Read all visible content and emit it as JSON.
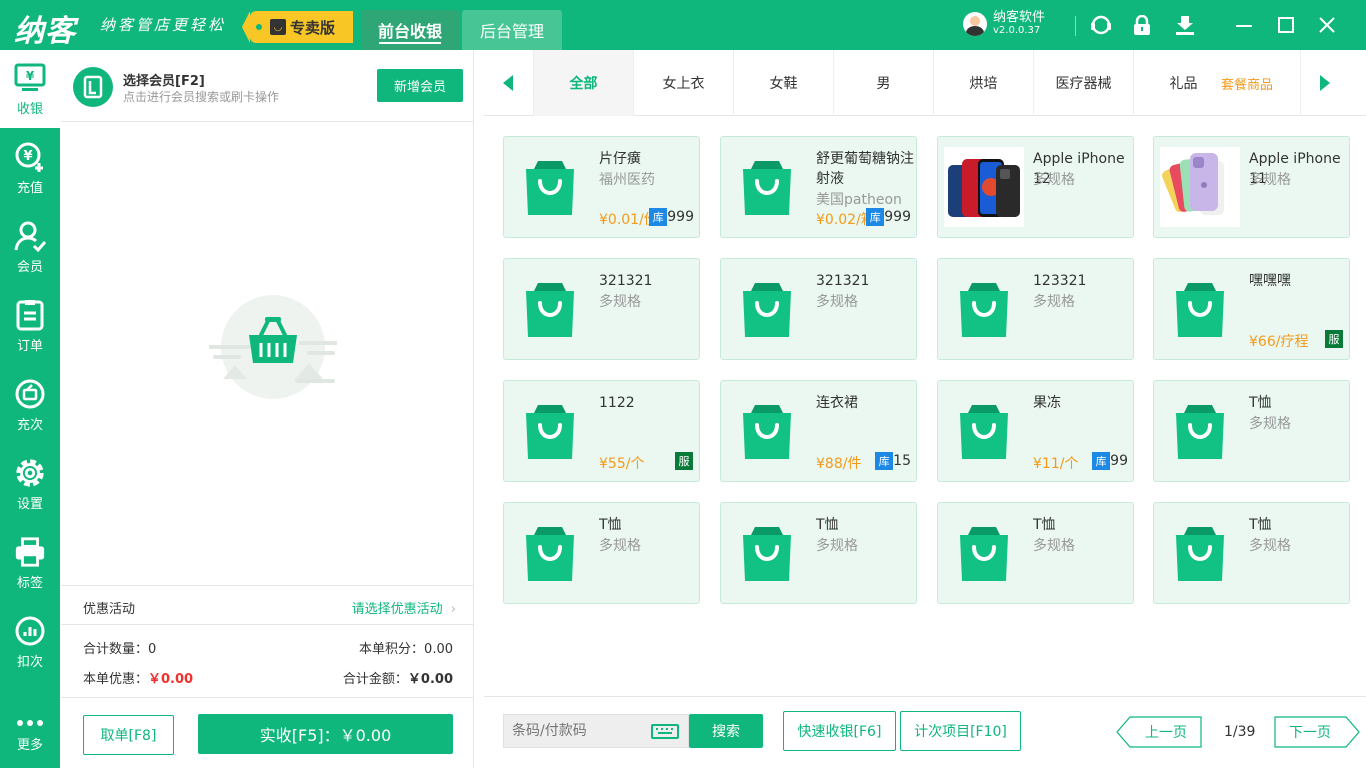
{
  "app": {
    "logo": "纳客",
    "slogan": "纳客管店更轻松",
    "edition": "专卖版",
    "tabs": [
      {
        "label": "前台收银",
        "active": true
      },
      {
        "label": "后台管理",
        "active": false
      }
    ],
    "user": {
      "name": "纳客软件",
      "version": "v2.0.0.37"
    },
    "window_icons": [
      "headset-icon",
      "lock-icon",
      "download-icon",
      "minimize-icon",
      "maximize-icon",
      "close-icon"
    ]
  },
  "sidebar": {
    "items": [
      {
        "label": "收银",
        "icon": "cashier-icon",
        "active": true
      },
      {
        "label": "充值",
        "icon": "recharge-icon",
        "active": false
      },
      {
        "label": "会员",
        "icon": "member-icon",
        "active": false
      },
      {
        "label": "订单",
        "icon": "order-icon",
        "active": false
      },
      {
        "label": "充次",
        "icon": "times-icon",
        "active": false
      },
      {
        "label": "设置",
        "icon": "settings-icon",
        "active": false
      },
      {
        "label": "标签",
        "icon": "printer-icon",
        "active": false
      },
      {
        "label": "扣次",
        "icon": "chart-icon",
        "active": false
      },
      {
        "label": "更多",
        "icon": "more-icon",
        "active": false
      }
    ]
  },
  "member": {
    "title": "选择会员[F2]",
    "subtitle": "点击进行会员搜索或刷卡操作",
    "add_button": "新增会员"
  },
  "promo": {
    "label": "优惠活动",
    "select": "请选择优惠活动"
  },
  "summary": {
    "qty_label": "合计数量：",
    "qty": "0",
    "points_label": "本单积分：",
    "points": "0.00",
    "discount_label": "本单优惠：",
    "discount": "￥0.00",
    "total_label": "合计金额：",
    "total": "￥0.00"
  },
  "actions": {
    "cancel": "取单[F8]",
    "pay": "实收[F5]：￥0.00"
  },
  "categories": [
    "全部",
    "女上衣",
    "女鞋",
    "男",
    "烘培",
    "医疗器械",
    "礼品"
  ],
  "category_tag": "套餐商品",
  "products": [
    {
      "name": "片仔癀",
      "sub": "福州医药",
      "price": "¥0.01/份",
      "stock": "999",
      "badge": "库",
      "img": "bag"
    },
    {
      "name": "舒更葡萄糖钠注射液",
      "sub": "美国patheon",
      "price": "¥0.02/箱",
      "stock": "999",
      "badge": "库",
      "img": "bag"
    },
    {
      "name": "Apple iPhone 12",
      "sub": "多规格",
      "price": "",
      "stock": "",
      "badge": "",
      "img": "iphone12"
    },
    {
      "name": "Apple iPhone 11",
      "sub": "多规格",
      "price": "",
      "stock": "",
      "badge": "",
      "img": "iphone11"
    },
    {
      "name": "321321",
      "sub": "多规格",
      "price": "",
      "stock": "",
      "badge": "",
      "img": "bag"
    },
    {
      "name": "321321",
      "sub": "多规格",
      "price": "",
      "stock": "",
      "badge": "",
      "img": "bag"
    },
    {
      "name": "123321",
      "sub": "多规格",
      "price": "",
      "stock": "",
      "badge": "",
      "img": "bag"
    },
    {
      "name": "嘿嘿嘿",
      "sub": "",
      "price": "¥66/疗程",
      "stock": "",
      "badge": "服",
      "img": "bag"
    },
    {
      "name": "1122",
      "sub": "",
      "price": "¥55/个",
      "stock": "",
      "badge": "服",
      "img": "bag"
    },
    {
      "name": "连衣裙",
      "sub": "",
      "price": "¥88/件",
      "stock": "15",
      "badge": "库",
      "img": "bag"
    },
    {
      "name": "果冻",
      "sub": "",
      "price": "¥11/个",
      "stock": "99",
      "badge": "库",
      "img": "bag"
    },
    {
      "name": "T恤",
      "sub": "多规格",
      "price": "",
      "stock": "",
      "badge": "",
      "img": "bag"
    },
    {
      "name": "T恤",
      "sub": "多规格",
      "price": "",
      "stock": "",
      "badge": "",
      "img": "bag"
    },
    {
      "name": "T恤",
      "sub": "多规格",
      "price": "",
      "stock": "",
      "badge": "",
      "img": "bag"
    },
    {
      "name": "T恤",
      "sub": "多规格",
      "price": "",
      "stock": "",
      "badge": "",
      "img": "bag"
    },
    {
      "name": "T恤",
      "sub": "多规格",
      "price": "",
      "stock": "",
      "badge": "",
      "img": "bag"
    }
  ],
  "footer": {
    "search_placeholder": "条码/付款码",
    "search_button": "搜索",
    "quick_checkout": "快速收银[F6]",
    "count_items": "计次项目[F10]",
    "prev": "上一页",
    "page": "1/39",
    "next": "下一页"
  },
  "colors": {
    "primary": "#0fb77c",
    "accent": "#f39a1a",
    "danger": "#f0302c",
    "stock_badge": "#1e88e5",
    "service_badge": "#0a7a38"
  }
}
